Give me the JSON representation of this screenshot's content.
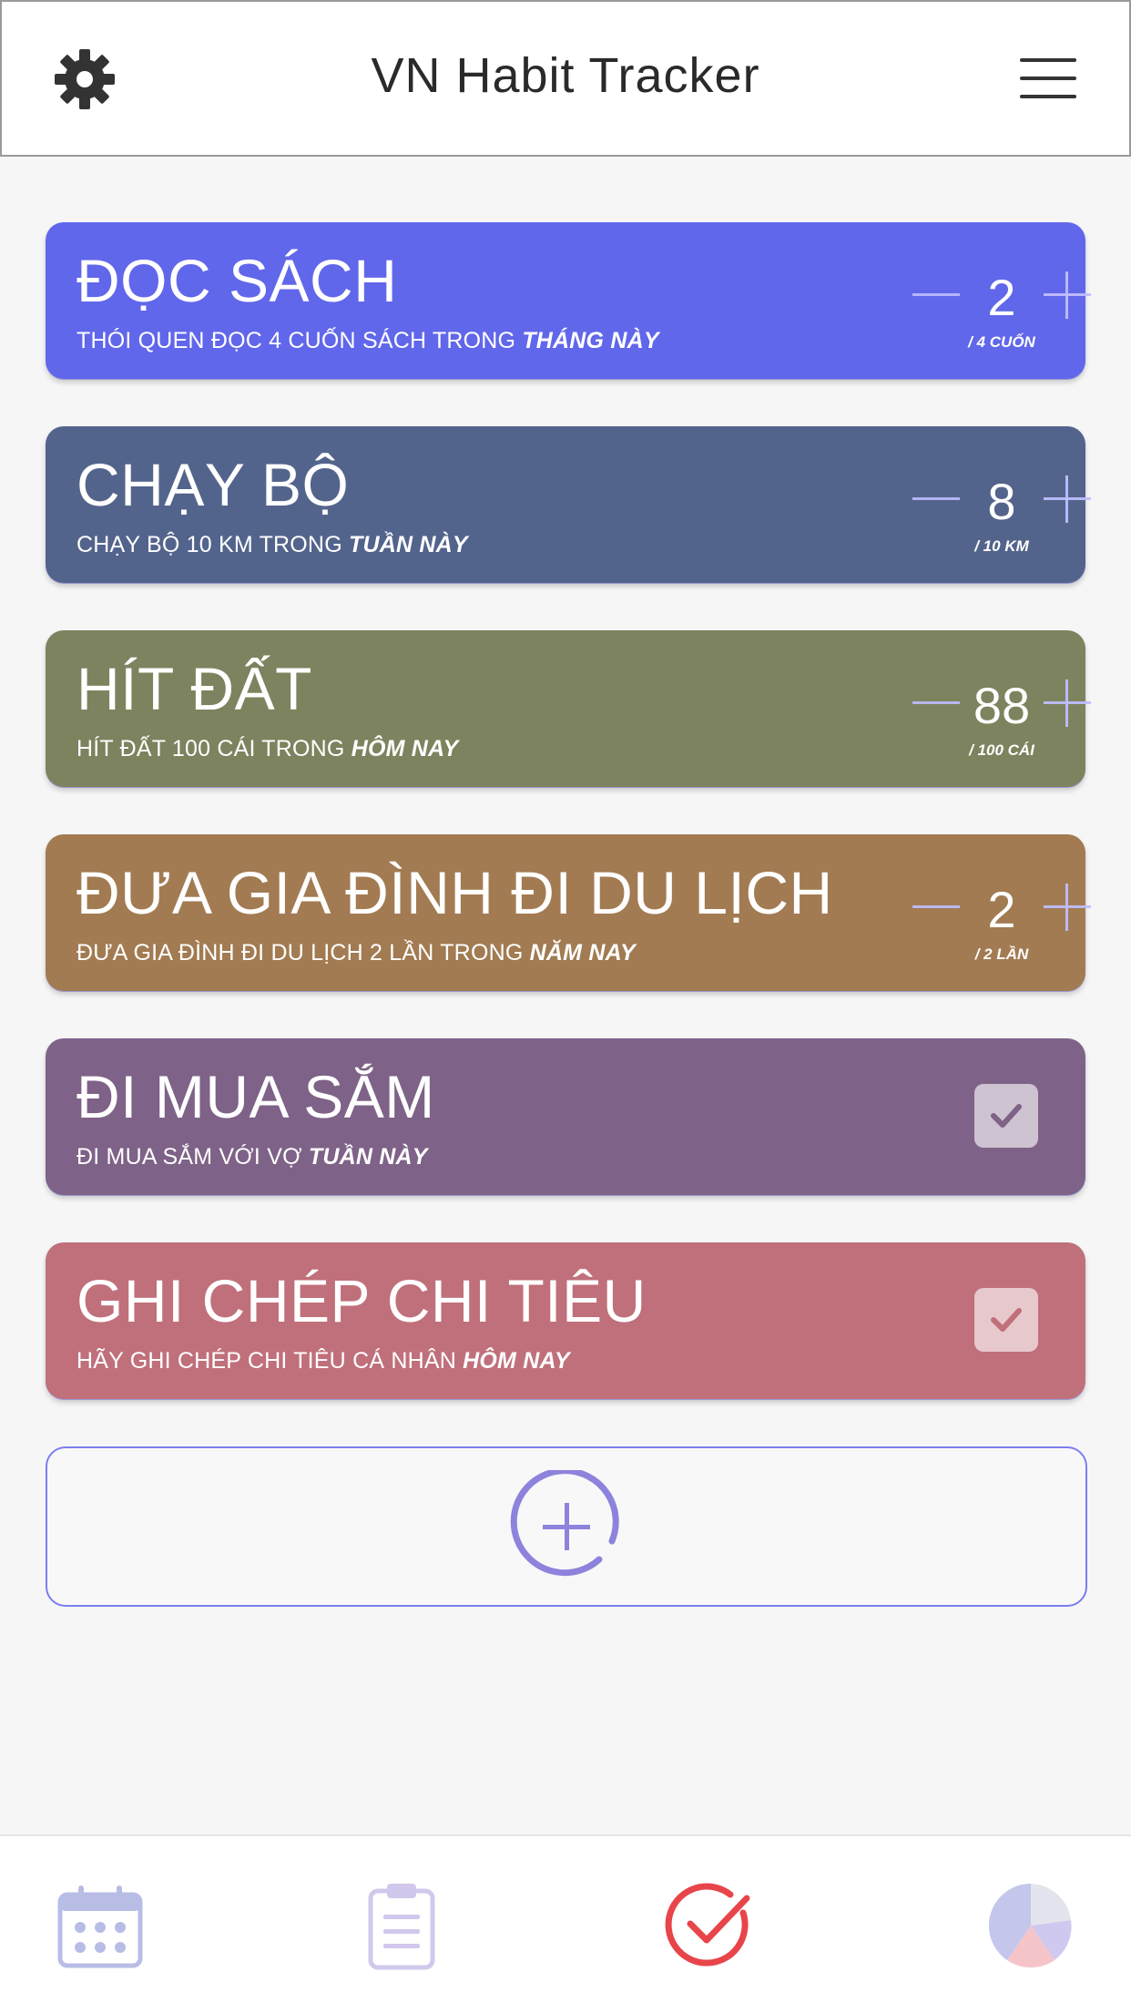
{
  "header": {
    "title": "VN Habit Tracker",
    "left_icon": "gear-icon",
    "right_icon": "hamburger-icon"
  },
  "habits": [
    {
      "name": "ĐỌC SÁCH",
      "desc": "THÓI QUEN ĐỌC 4 CUỐN SÁCH TRONG",
      "period": "THÁNG NÀY",
      "type": "counter",
      "value": "2",
      "unit": "/ 4 CUỐN",
      "color": "#6167ea"
    },
    {
      "name": "CHẠY BỘ",
      "desc": "CHẠY BỘ 10 KM TRONG",
      "period": "TUẦN NÀY",
      "type": "counter",
      "value": "8",
      "unit": "/ 10 KM",
      "color": "#53648c"
    },
    {
      "name": "HÍT ĐẤT",
      "desc": "HÍT ĐẤT 100 CÁI TRONG",
      "period": "HÔM NAY",
      "type": "counter",
      "value": "88",
      "unit": "/ 100 CÁI",
      "color": "#7d835e"
    },
    {
      "name": "ĐƯA GIA ĐÌNH ĐI DU LỊCH",
      "desc": "ĐƯA GIA ĐÌNH ĐI DU LỊCH 2 LẦN TRONG",
      "period": "NĂM NAY",
      "type": "counter",
      "value": "2",
      "unit": "/ 2 LẦN",
      "color": "#a27b52"
    },
    {
      "name": "ĐI MUA SẮM",
      "desc": "ĐI MUA SẮM VỚI VỢ",
      "period": "TUẦN NÀY",
      "type": "check",
      "checked": true,
      "color": "#7e6287"
    },
    {
      "name": "GHI CHÉP CHI TIÊU",
      "desc": "HÃY GHI CHÉP CHI TIÊU CÁ NHÂN",
      "period": "HÔM NAY",
      "type": "check",
      "checked": true,
      "color": "#c0707b"
    }
  ],
  "add_button_icon": "add-circle-icon",
  "tabbar": [
    {
      "icon": "calendar-icon",
      "active": false
    },
    {
      "icon": "clipboard-icon",
      "active": false
    },
    {
      "icon": "check-circle-icon",
      "active": true
    },
    {
      "icon": "pie-chart-icon",
      "active": false
    }
  ],
  "colors": {
    "accent": "#7b7ef0",
    "active_tab": "#e8454b"
  }
}
